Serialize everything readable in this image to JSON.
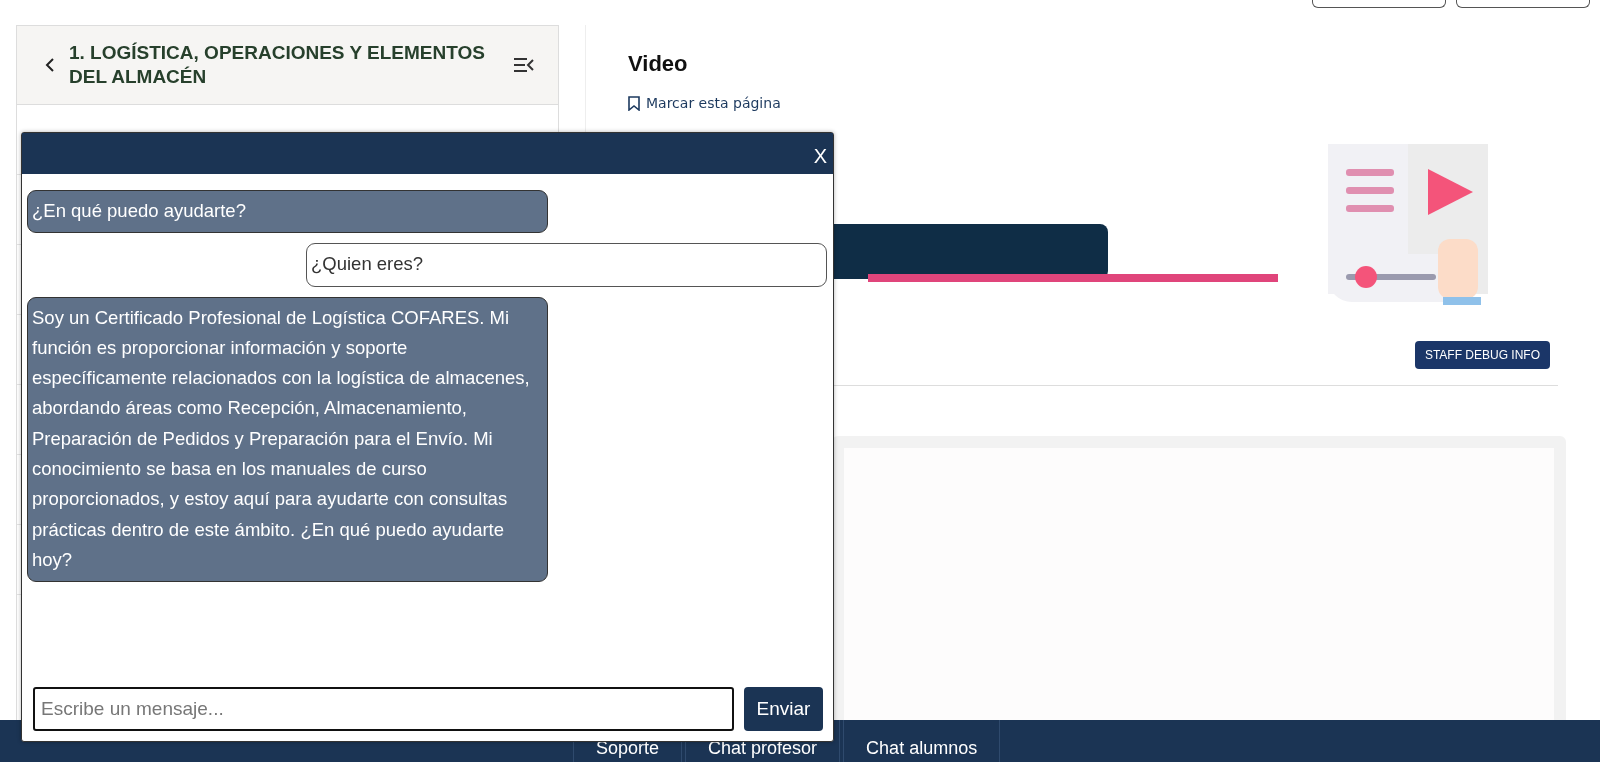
{
  "course_nav": {
    "title": "1. LOGÍSTICA, OPERACIONES Y ELEMENTOS DEL ALMACÉN"
  },
  "unit": {
    "title": "Video",
    "bookmark": "Marcar esta página",
    "debug_button": "STAFF DEBUG INFO"
  },
  "bottom_tabs": [
    {
      "label": "Soporte"
    },
    {
      "label": "Chat profesor"
    },
    {
      "label": "Chat alumnos"
    }
  ],
  "chat": {
    "close": "X",
    "messages": [
      {
        "kind": "bot",
        "text": "¿En qué puedo ayudarte?"
      },
      {
        "kind": "user",
        "text": "¿Quien eres?"
      },
      {
        "kind": "bot",
        "text": "Soy un Certificado Profesional de Logística COFARES. Mi función es proporcionar información y soporte específicamente relacionados con la logística de almacenes, abordando áreas como Recepción, Almacenamiento, Preparación de Pedidos y Preparación para el Envío. Mi conocimiento se basa en los manuales de curso proporcionados, y estoy aquí para ayudarte con consultas prácticas dentro de este ámbito. ¿En qué puedo ayudarte hoy?"
      }
    ],
    "input": {
      "placeholder": "Escribe un mensaje..."
    },
    "send": "Enviar"
  }
}
